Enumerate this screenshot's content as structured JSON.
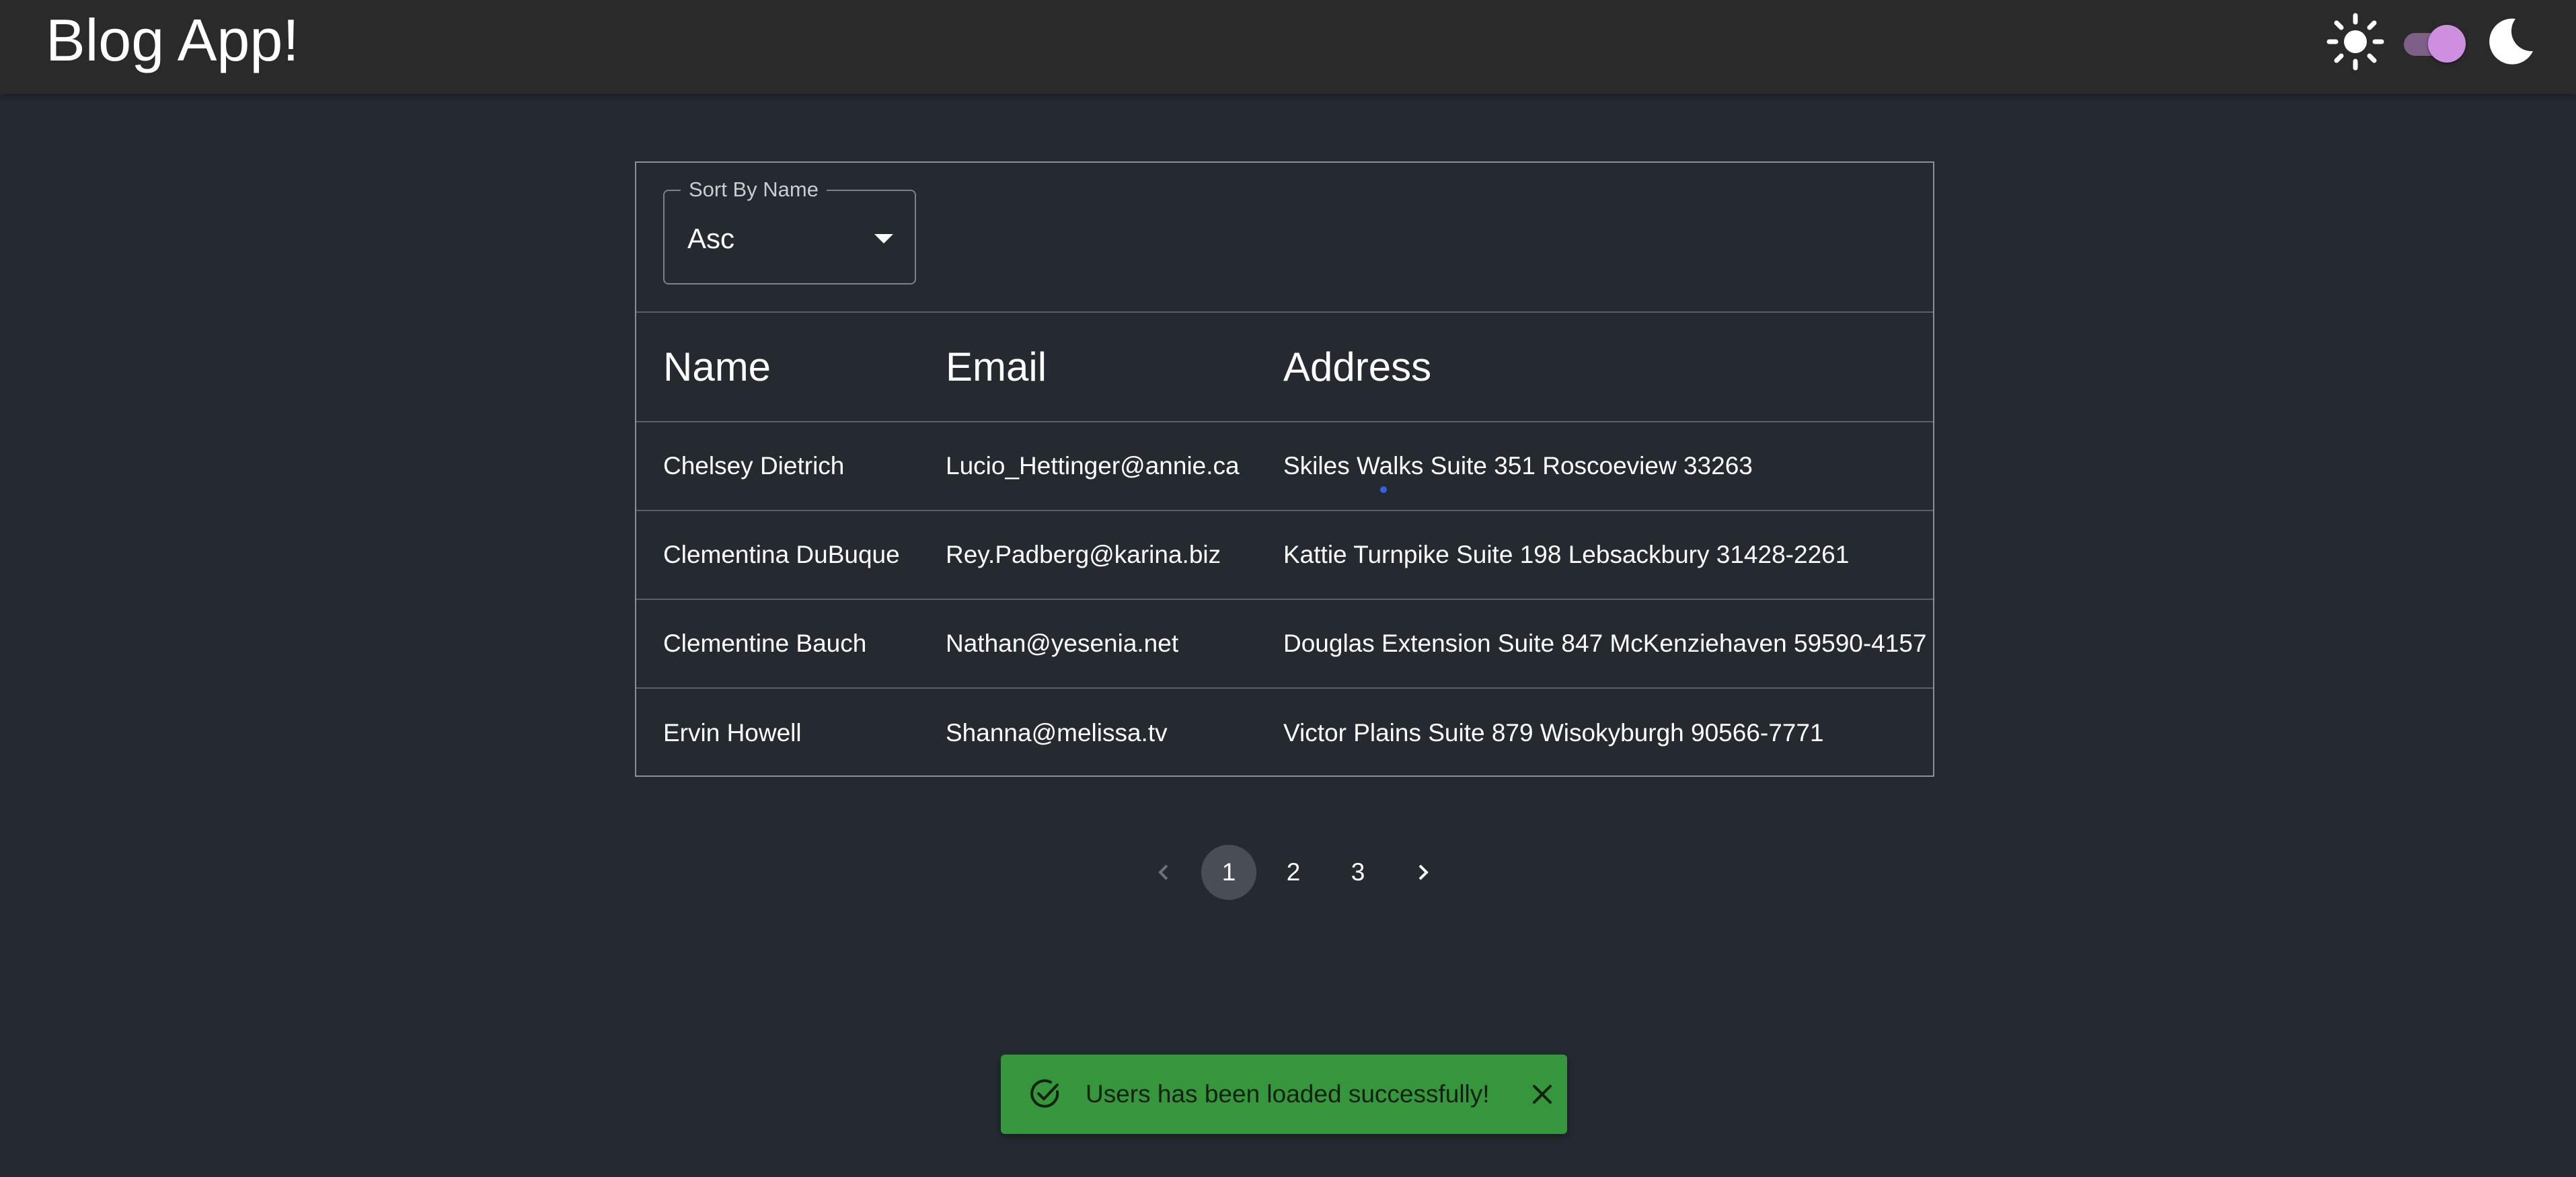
{
  "header": {
    "title": "Blog App!",
    "theme_toggle_checked": true,
    "icons": [
      "sun-icon",
      "moon-icon"
    ]
  },
  "sort": {
    "label": "Sort By Name",
    "value": "Asc"
  },
  "table": {
    "columns": [
      "Name",
      "Email",
      "Address"
    ],
    "rows": [
      {
        "name": "Chelsey Dietrich",
        "email": "Lucio_Hettinger@annie.ca",
        "address": "Skiles Walks Suite 351 Roscoeview 33263"
      },
      {
        "name": "Clementina DuBuque",
        "email": "Rey.Padberg@karina.biz",
        "address": "Kattie Turnpike Suite 198 Lebsackbury 31428-2261"
      },
      {
        "name": "Clementine Bauch",
        "email": "Nathan@yesenia.net",
        "address": "Douglas Extension Suite 847 McKenziehaven 59590-4157"
      },
      {
        "name": "Ervin Howell",
        "email": "Shanna@melissa.tv",
        "address": "Victor Plains Suite 879 Wisokyburgh 90566-7771"
      }
    ]
  },
  "pagination": {
    "pages": [
      "1",
      "2",
      "3"
    ],
    "current": "1"
  },
  "snackbar": {
    "message": "Users has been loaded successfully!",
    "color": "#36963b"
  },
  "colors": {
    "background": "#252a31",
    "topbar": "#2a2a2a",
    "toggle_thumb": "#cf8fe0"
  }
}
